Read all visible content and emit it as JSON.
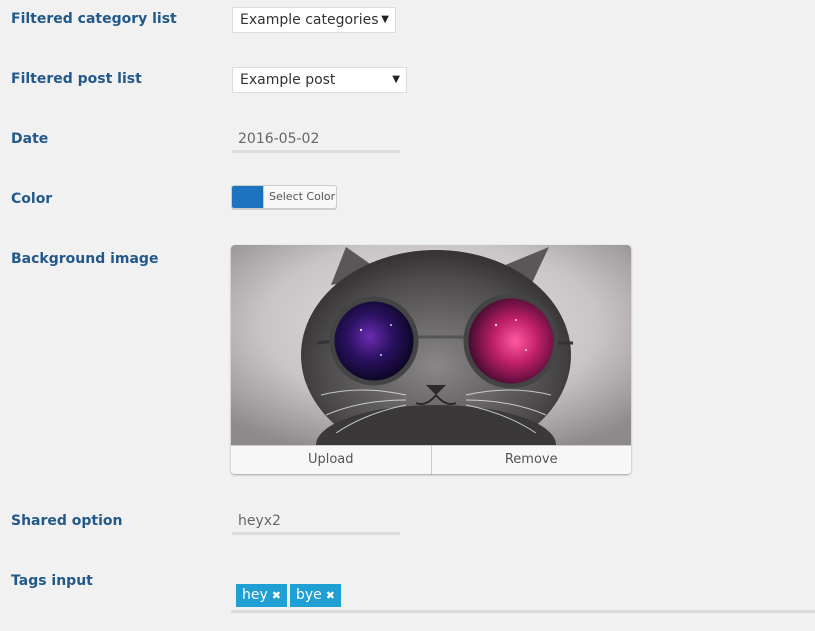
{
  "fields": {
    "category": {
      "label": "Filtered category list",
      "value": "Example categories"
    },
    "post": {
      "label": "Filtered post list",
      "value": "Example post"
    },
    "date": {
      "label": "Date",
      "value": "2016-05-02"
    },
    "color": {
      "label": "Color",
      "button_text": "Select Color",
      "value": "#1e73be"
    },
    "background": {
      "label": "Background image",
      "upload": "Upload",
      "remove": "Remove"
    },
    "shared": {
      "label": "Shared option",
      "value": "heyx2"
    },
    "tags": {
      "label": "Tags input",
      "items": [
        "hey",
        "bye"
      ]
    }
  }
}
